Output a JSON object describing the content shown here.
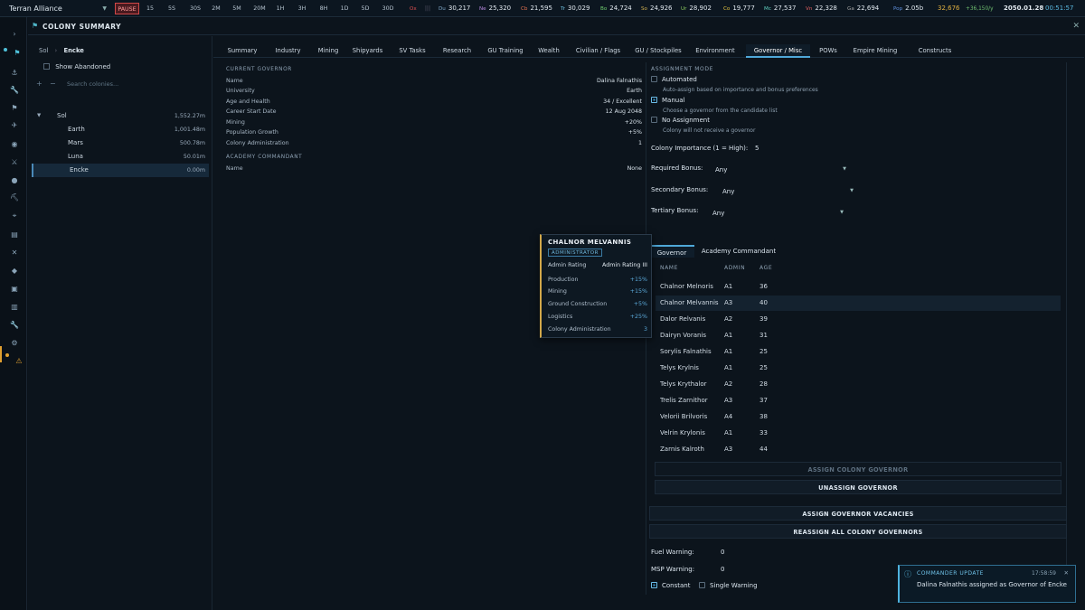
{
  "topbar": {
    "empire": "Terran Alliance",
    "speeds": [
      "PAUSE",
      "15",
      "5S",
      "30S",
      "2M",
      "5M",
      "20M",
      "1H",
      "3H",
      "8H",
      "1D",
      "5D",
      "30D"
    ],
    "resources": [
      {
        "label": "Ox",
        "value": "",
        "color": "#e05050"
      },
      {
        "label": "Du",
        "value": "30,217",
        "color": "#7fa8c8"
      },
      {
        "label": "Ne",
        "value": "25,320",
        "color": "#b88ae0"
      },
      {
        "label": "Cb",
        "value": "21,595",
        "color": "#e07050"
      },
      {
        "label": "Tr",
        "value": "30,029",
        "color": "#70c0e0"
      },
      {
        "label": "Bo",
        "value": "24,724",
        "color": "#70d070"
      },
      {
        "label": "So",
        "value": "24,926",
        "color": "#d0b050"
      },
      {
        "label": "Ur",
        "value": "28,902",
        "color": "#90d060"
      },
      {
        "label": "Co",
        "value": "19,777",
        "color": "#e0c040"
      },
      {
        "label": "Mc",
        "value": "27,537",
        "color": "#60d0c0"
      },
      {
        "label": "Vn",
        "value": "22,328",
        "color": "#e06060"
      },
      {
        "label": "Ga",
        "value": "22,694",
        "color": "#a0a0a0"
      },
      {
        "label": "Pop",
        "value": "2.05b",
        "color": "#6090e0"
      },
      {
        "label": "",
        "value": "32,676",
        "color": "#e0b040"
      },
      {
        "label": "",
        "value": "+36,150/y",
        "color": "#70c070"
      }
    ],
    "date": "2050.01.28",
    "time": "00:51:57"
  },
  "window": {
    "title": "COLONY SUMMARY"
  },
  "left": {
    "breadcrumb_root": "Sol",
    "breadcrumb_current": "Encke",
    "show_abandoned": "Show Abandoned",
    "search_placeholder": "Search colonies...",
    "colonies": [
      {
        "name": "Sol",
        "value": "1,552.27m",
        "indent": 0,
        "system": true
      },
      {
        "name": "Earth",
        "value": "1,001.48m",
        "indent": 1
      },
      {
        "name": "Mars",
        "value": "500.78m",
        "indent": 1
      },
      {
        "name": "Luna",
        "value": "50.01m",
        "indent": 1
      },
      {
        "name": "Encke",
        "value": "0.00m",
        "indent": 1,
        "selected": true
      }
    ]
  },
  "tabs": [
    "Summary",
    "Industry",
    "Mining",
    "Shipyards",
    "SV Tasks",
    "Research",
    "GU Training",
    "Wealth",
    "Civilian / Flags",
    "GU / Stockpiles",
    "Environment",
    "Governor / Misc",
    "POWs",
    "Empire Mining",
    "Constructs"
  ],
  "active_tab": "Governor / Misc",
  "current_governor": {
    "heading": "CURRENT GOVERNOR",
    "rows": [
      {
        "k": "Name",
        "v": "Dalina Falnathis"
      },
      {
        "k": "University",
        "v": "Earth"
      },
      {
        "k": "Age and Health",
        "v": "34 / Excellent"
      },
      {
        "k": "Career Start Date",
        "v": "12 Aug 2048"
      },
      {
        "k": "Mining",
        "v": "+20%"
      },
      {
        "k": "Population Growth",
        "v": "+5%"
      },
      {
        "k": "Colony Administration",
        "v": "1"
      }
    ]
  },
  "academy": {
    "heading": "ACADEMY COMMANDANT",
    "rows": [
      {
        "k": "Name",
        "v": "None"
      }
    ]
  },
  "assignment": {
    "heading": "ASSIGNMENT MODE",
    "options": [
      {
        "label": "Automated",
        "desc": "Auto-assign based on importance and bonus preferences",
        "checked": false
      },
      {
        "label": "Manual",
        "desc": "Choose a governor from the candidate list",
        "checked": true
      },
      {
        "label": "No Assignment",
        "desc": "Colony will not receive a governor",
        "checked": false
      }
    ],
    "importance_label": "Colony Importance (1 = High):",
    "importance_value": "5",
    "required_label": "Required Bonus:",
    "required_value": "Any",
    "secondary_label": "Secondary Bonus:",
    "secondary_value": "Any",
    "tertiary_label": "Tertiary Bonus:",
    "tertiary_value": "Any"
  },
  "subtabs": [
    "Governor",
    "Academy Commandant"
  ],
  "candidates": {
    "headers": [
      "NAME",
      "ADMIN",
      "AGE"
    ],
    "rows": [
      [
        "Chalnor Melnoris",
        "A1",
        "36"
      ],
      [
        "Chalnor Melvannis",
        "A3",
        "40"
      ],
      [
        "Dalor Relvanis",
        "A2",
        "39"
      ],
      [
        "Dairyn Voranis",
        "A1",
        "31"
      ],
      [
        "Sorylis Falnathis",
        "A1",
        "25"
      ],
      [
        "Telys Krylnis",
        "A1",
        "25"
      ],
      [
        "Telys Krythalor",
        "A2",
        "28"
      ],
      [
        "Trelis Zarnithor",
        "A3",
        "37"
      ],
      [
        "Velorii Brilvoris",
        "A4",
        "38"
      ],
      [
        "Velrin Krylonis",
        "A1",
        "33"
      ],
      [
        "Zarnis Kalroth",
        "A3",
        "44"
      ]
    ]
  },
  "buttons": {
    "assign": "ASSIGN COLONY GOVERNOR",
    "unassign": "UNASSIGN GOVERNOR",
    "vacancies": "ASSIGN GOVERNOR VACANCIES",
    "reassign": "REASSIGN ALL COLONY GOVERNORS"
  },
  "warnings": {
    "fuel_label": "Fuel Warning:",
    "fuel_value": "0",
    "msp_label": "MSP Warning:",
    "msp_value": "0",
    "constant": "Constant",
    "single": "Single Warning"
  },
  "tooltip": {
    "name": "CHALNOR MELVANNIS",
    "role": "ADMINISTRATOR",
    "rating_label": "Admin Rating",
    "rating_value": "Admin Rating III",
    "rows": [
      {
        "k": "Production",
        "v": "+15%"
      },
      {
        "k": "Mining",
        "v": "+15%"
      },
      {
        "k": "Ground Construction",
        "v": "+5%"
      },
      {
        "k": "Logistics",
        "v": "+25%"
      },
      {
        "k": "Colony Administration",
        "v": "3"
      }
    ]
  },
  "toast": {
    "heading": "COMMANDER UPDATE",
    "time": "17:58:59",
    "message": "Dalina Falnathis assigned as Governor of Encke"
  }
}
